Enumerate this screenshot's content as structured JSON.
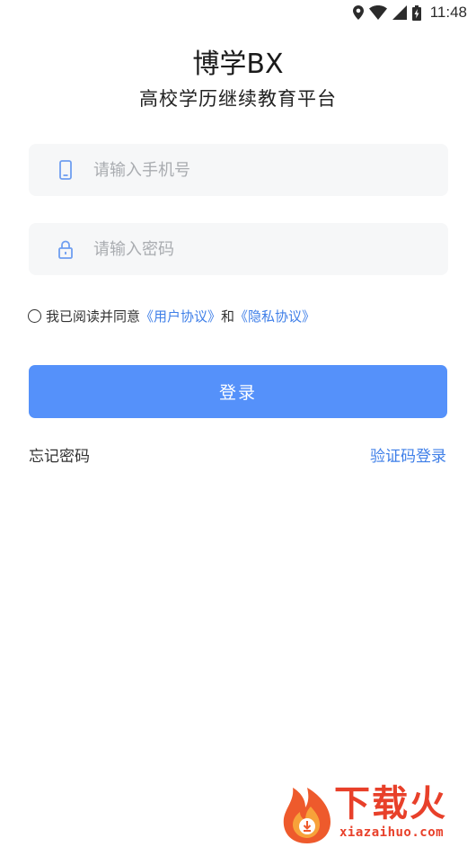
{
  "status_bar": {
    "time": "11:48"
  },
  "header": {
    "title": "博学BX",
    "subtitle": "高校学历继续教育平台"
  },
  "form": {
    "phone_placeholder": "请输入手机号",
    "phone_value": "",
    "password_placeholder": "请输入密码",
    "password_value": ""
  },
  "agreement": {
    "prefix": "我已阅读并同意",
    "user_agreement": "《用户协议》",
    "conjunction": "和",
    "privacy_policy": "《隐私协议》"
  },
  "login_button_label": "登录",
  "links": {
    "forgot_password": "忘记密码",
    "sms_login": "验证码登录"
  },
  "watermark": {
    "brand": "下载火",
    "url": "xiazaihuo.com"
  },
  "colors": {
    "accent": "#5591fa",
    "link": "#3f7fe8",
    "field_bg": "#f6f7f8",
    "watermark": "#e8402a"
  }
}
